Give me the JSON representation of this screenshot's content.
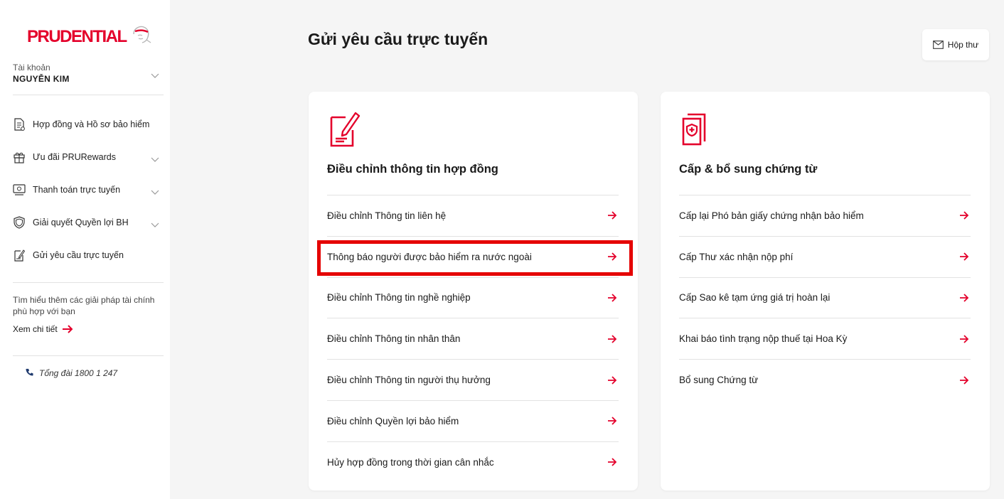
{
  "brand": {
    "logo_text": "PRUDENTIAL",
    "accent_color": "#e4002b"
  },
  "account": {
    "label": "Tài khoản",
    "name": "NGUYỄN KIM"
  },
  "nav": {
    "items": [
      {
        "label": "Hợp đồng và Hồ sơ bảo hiểm",
        "icon": "document-icon",
        "expandable": false
      },
      {
        "label": "Ưu đãi PRURewards",
        "icon": "gift-icon",
        "expandable": true
      },
      {
        "label": "Thanh toán trực tuyến",
        "icon": "payment-icon",
        "expandable": true
      },
      {
        "label": "Giải quyết Quyền lợi BH",
        "icon": "shield-icon",
        "expandable": true
      },
      {
        "label": "Gửi yêu cầu trực tuyến",
        "icon": "edit-document-icon",
        "expandable": false
      }
    ]
  },
  "promo": {
    "text": "Tìm hiểu thêm các giải pháp tài chính phù hợp với bạn",
    "link_label": "Xem chi tiết"
  },
  "hotline": {
    "text": "Tổng đài 1800 1 247"
  },
  "header": {
    "title": "Gửi yêu cầu trực tuyến",
    "inbox_label": "Hộp thư"
  },
  "cards": {
    "left": {
      "title": "Điều chỉnh thông tin hợp đồng",
      "items": [
        {
          "label": "Điều chỉnh Thông tin liên hệ"
        },
        {
          "label": "Thông báo người được bảo hiểm ra nước ngoài"
        },
        {
          "label": "Điều chỉnh Thông tin nghề nghiệp"
        },
        {
          "label": "Điều chỉnh Thông tin nhân thân"
        },
        {
          "label": "Điều chỉnh Thông tin người thụ hưởng"
        },
        {
          "label": "Điều chỉnh Quyền lợi bảo hiểm"
        },
        {
          "label": "Hủy hợp đồng trong thời gian cân nhắc"
        }
      ]
    },
    "right": {
      "title": "Cấp & bổ sung chứng từ",
      "items": [
        {
          "label": "Cấp lại Phó bản giấy chứng nhận bảo hiểm"
        },
        {
          "label": "Cấp Thư xác nhận nộp phí"
        },
        {
          "label": "Cấp Sao kê tạm ứng giá trị hoàn lại"
        },
        {
          "label": "Khai báo tình trạng nộp thuế tại Hoa Kỳ"
        },
        {
          "label": "Bổ sung Chứng từ"
        }
      ]
    }
  },
  "highlight_color": "#e50000"
}
